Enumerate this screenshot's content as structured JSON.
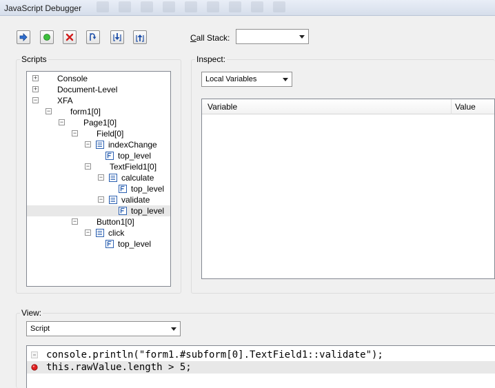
{
  "window": {
    "title": "JavaScript Debugger"
  },
  "toolbar": {
    "buttons": [
      {
        "name": "continue",
        "icon": "arrow-right-icon"
      },
      {
        "name": "stop",
        "icon": "green-circle-icon"
      },
      {
        "name": "close",
        "icon": "red-x-icon"
      },
      {
        "name": "step-over",
        "icon": "step-over-icon"
      },
      {
        "name": "step-into",
        "icon": "step-into-icon"
      },
      {
        "name": "step-out",
        "icon": "step-out-icon"
      }
    ],
    "call_stack_label_prefix": "C",
    "call_stack_label_rest": "all Stack:",
    "call_stack_value": ""
  },
  "scripts": {
    "title": "Scripts",
    "tree": [
      {
        "label": "Console",
        "expander": "+",
        "icon": null
      },
      {
        "label": "Document-Level",
        "expander": "+",
        "icon": null
      },
      {
        "label": "XFA",
        "expander": "−",
        "icon": null
      },
      {
        "label": "form1[0]",
        "expander": "−",
        "icon": null
      },
      {
        "label": "Page1[0]",
        "expander": "−",
        "icon": null
      },
      {
        "label": "Field[0]",
        "expander": "−",
        "icon": null
      },
      {
        "label": "indexChange",
        "expander": "−",
        "icon": "event-list-icon"
      },
      {
        "label": "top_level",
        "expander": null,
        "icon": "script-file-icon"
      },
      {
        "label": "TextField1[0]",
        "expander": "−",
        "icon": null
      },
      {
        "label": "calculate",
        "expander": "−",
        "icon": "event-list-icon"
      },
      {
        "label": "top_level",
        "expander": null,
        "icon": "script-file-icon"
      },
      {
        "label": "validate",
        "expander": "−",
        "icon": "event-list-icon"
      },
      {
        "label": "top_level",
        "expander": null,
        "icon": "script-file-icon",
        "selected": true
      },
      {
        "label": "Button1[0]",
        "expander": "−",
        "icon": null
      },
      {
        "label": "click",
        "expander": "−",
        "icon": "event-list-icon"
      },
      {
        "label": "top_level",
        "expander": null,
        "icon": "script-file-icon"
      }
    ]
  },
  "inspect": {
    "title": "Inspect:",
    "dropdown_value": "Local Variables",
    "columns": [
      "Variable",
      "Value"
    ]
  },
  "view": {
    "title": "View:",
    "dropdown_value": "Script",
    "code_lines": [
      {
        "text": "console.println(\"form1.#subform[0].TextField1::validate\");",
        "marker": "dash"
      },
      {
        "text": "this.rawValue.length > 5;",
        "marker": "breakpoint"
      }
    ]
  },
  "colors": {
    "breakpoint": "#e02020",
    "selection_row": "#e8e8e8",
    "icon_blue": "#2a5fb0"
  }
}
